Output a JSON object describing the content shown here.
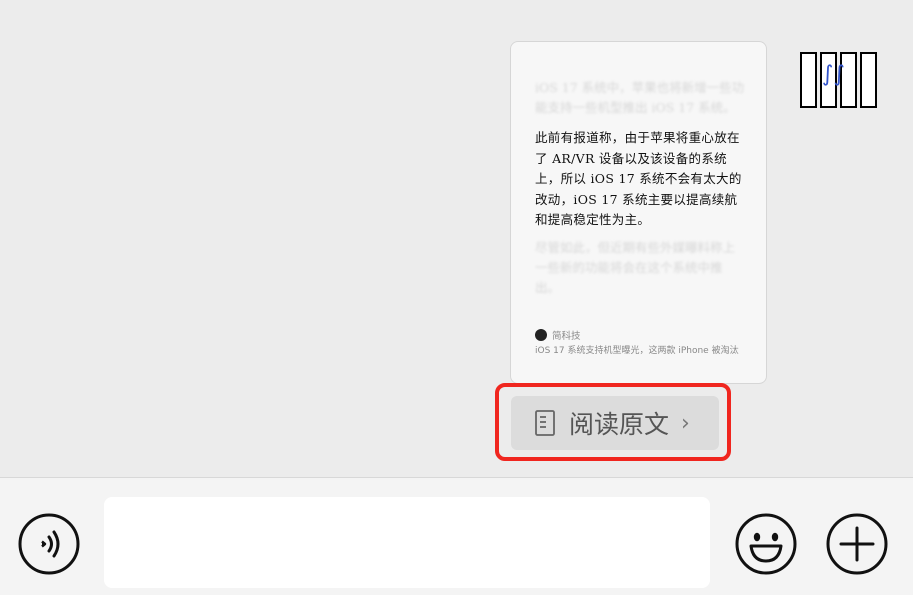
{
  "card": {
    "faded_top": "iOS 17 系统中，苹果也将新增一些功能支持一些机型推出 iOS 17 系统。",
    "body": "此前有报道称，由于苹果将重心放在了 AR/VR 设备以及该设备的系统上，所以 iOS 17 系统不会有太大的改动，iOS 17 系统主要以提高续航和提高稳定性为主。",
    "faded_bottom": "尽管如此，但近期有些外媒曝料称上一些新的功能将会在这个系统中推出。",
    "source_name": "简科技",
    "caption": "iOS 17 系统支持机型曝光，这两款 iPhone 被淘汰"
  },
  "read_button": {
    "label": "阅读原文",
    "chevron": "›"
  },
  "input": {
    "value": "",
    "placeholder": ""
  },
  "icons": {
    "voice": "voice-icon",
    "emoji": "emoji-icon",
    "plus": "plus-icon",
    "document": "document-icon"
  },
  "colors": {
    "highlight": "#f0261f",
    "chat_bg": "#ececec",
    "input_bar_bg": "#f4f4f4"
  }
}
